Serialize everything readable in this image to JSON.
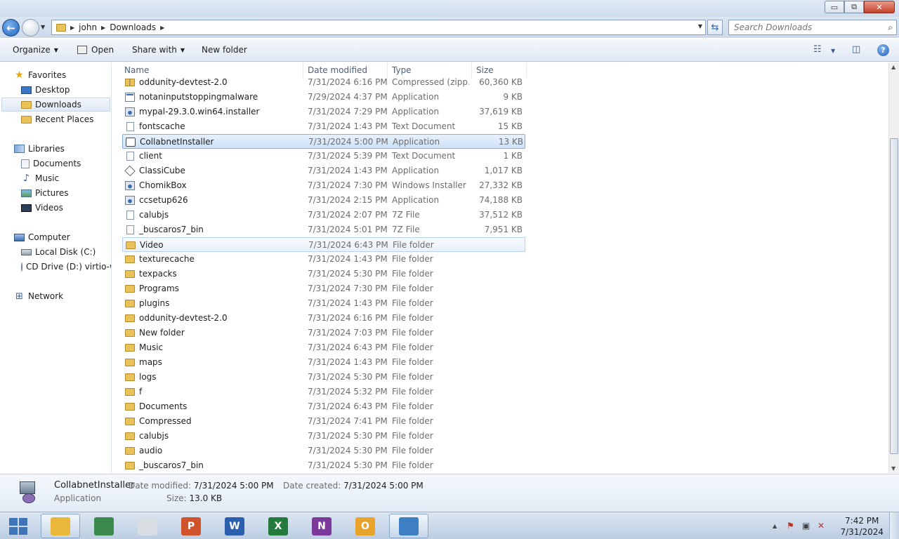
{
  "window": {
    "minimize": "▭",
    "maximize": "⧉",
    "close": "✕"
  },
  "address": {
    "crumbs": [
      "john",
      "Downloads"
    ],
    "search_placeholder": "Search Downloads"
  },
  "toolbar": {
    "organize": "Organize",
    "open": "Open",
    "share_with": "Share with",
    "new_folder": "New folder"
  },
  "nav": {
    "favorites": "Favorites",
    "desktop": "Desktop",
    "downloads": "Downloads",
    "recent_places": "Recent Places",
    "libraries": "Libraries",
    "documents": "Documents",
    "music": "Music",
    "pictures": "Pictures",
    "videos": "Videos",
    "computer": "Computer",
    "local_disk": "Local Disk (C:)",
    "cd_drive": "CD Drive (D:) virtio-w",
    "network": "Network"
  },
  "columns": {
    "name": "Name",
    "date": "Date modified",
    "type": "Type",
    "size": "Size"
  },
  "files": [
    {
      "name": "oddunity-devtest-2.0",
      "date": "7/31/2024 6:16 PM",
      "type": "Compressed (zipp...",
      "size": "60,360 KB",
      "icon": "zip"
    },
    {
      "name": "notaninputstoppingmalware",
      "date": "7/29/2024 4:37 PM",
      "type": "Application",
      "size": "9 KB",
      "icon": "app"
    },
    {
      "name": "mypal-29.3.0.win64.installer",
      "date": "7/31/2024 7:29 PM",
      "type": "Application",
      "size": "37,619 KB",
      "icon": "inst"
    },
    {
      "name": "fontscache",
      "date": "7/31/2024 1:43 PM",
      "type": "Text Document",
      "size": "15 KB",
      "icon": "txt"
    },
    {
      "name": "CollabnetInstaller",
      "date": "7/31/2024 5:00 PM",
      "type": "Application",
      "size": "13 KB",
      "icon": "gear"
    },
    {
      "name": "client",
      "date": "7/31/2024 5:39 PM",
      "type": "Text Document",
      "size": "1 KB",
      "icon": "txt"
    },
    {
      "name": "ClassiCube",
      "date": "7/31/2024 1:43 PM",
      "type": "Application",
      "size": "1,017 KB",
      "icon": "cube"
    },
    {
      "name": "ChomikBox",
      "date": "7/31/2024 7:30 PM",
      "type": "Windows Installer ...",
      "size": "27,332 KB",
      "icon": "inst"
    },
    {
      "name": "ccsetup626",
      "date": "7/31/2024 2:15 PM",
      "type": "Application",
      "size": "74,188 KB",
      "icon": "inst"
    },
    {
      "name": "calubjs",
      "date": "7/31/2024 2:07 PM",
      "type": "7Z File",
      "size": "37,512 KB",
      "icon": "txt"
    },
    {
      "name": "_buscaros7_bin",
      "date": "7/31/2024 5:01 PM",
      "type": "7Z File",
      "size": "7,951 KB",
      "icon": "txt"
    },
    {
      "name": "Video",
      "date": "7/31/2024 6:43 PM",
      "type": "File folder",
      "size": "",
      "icon": "folder"
    },
    {
      "name": "texturecache",
      "date": "7/31/2024 1:43 PM",
      "type": "File folder",
      "size": "",
      "icon": "folder"
    },
    {
      "name": "texpacks",
      "date": "7/31/2024 5:30 PM",
      "type": "File folder",
      "size": "",
      "icon": "folder"
    },
    {
      "name": "Programs",
      "date": "7/31/2024 7:30 PM",
      "type": "File folder",
      "size": "",
      "icon": "folder"
    },
    {
      "name": "plugins",
      "date": "7/31/2024 1:43 PM",
      "type": "File folder",
      "size": "",
      "icon": "folder"
    },
    {
      "name": "oddunity-devtest-2.0",
      "date": "7/31/2024 6:16 PM",
      "type": "File folder",
      "size": "",
      "icon": "folder"
    },
    {
      "name": "New folder",
      "date": "7/31/2024 7:03 PM",
      "type": "File folder",
      "size": "",
      "icon": "folder"
    },
    {
      "name": "Music",
      "date": "7/31/2024 6:43 PM",
      "type": "File folder",
      "size": "",
      "icon": "folder"
    },
    {
      "name": "maps",
      "date": "7/31/2024 1:43 PM",
      "type": "File folder",
      "size": "",
      "icon": "folder"
    },
    {
      "name": "logs",
      "date": "7/31/2024 5:30 PM",
      "type": "File folder",
      "size": "",
      "icon": "folder"
    },
    {
      "name": "f",
      "date": "7/31/2024 5:32 PM",
      "type": "File folder",
      "size": "",
      "icon": "folder"
    },
    {
      "name": "Documents",
      "date": "7/31/2024 6:43 PM",
      "type": "File folder",
      "size": "",
      "icon": "folder"
    },
    {
      "name": "Compressed",
      "date": "7/31/2024 7:41 PM",
      "type": "File folder",
      "size": "",
      "icon": "folder"
    },
    {
      "name": "calubjs",
      "date": "7/31/2024 5:30 PM",
      "type": "File folder",
      "size": "",
      "icon": "folder"
    },
    {
      "name": "audio",
      "date": "7/31/2024 5:30 PM",
      "type": "File folder",
      "size": "",
      "icon": "folder"
    },
    {
      "name": "_buscaros7_bin",
      "date": "7/31/2024 5:30 PM",
      "type": "File folder",
      "size": "",
      "icon": "folder"
    }
  ],
  "selected_file": "CollabnetInstaller",
  "hovered_file": "Video",
  "details": {
    "name": "CollabnetInstaller",
    "type": "Application",
    "date_modified_label": "Date modified:",
    "date_modified": "7/31/2024 5:00 PM",
    "date_created_label": "Date created:",
    "date_created": "7/31/2024 5:00 PM",
    "size_label": "Size:",
    "size": "13.0 KB"
  },
  "taskbar": {
    "apps": [
      {
        "name": "explorer",
        "letter": "",
        "color": "#e9b83a"
      },
      {
        "name": "chrome-like",
        "letter": "",
        "color": "#3b8a4c"
      },
      {
        "name": "box",
        "letter": "",
        "color": "#d8dde3"
      },
      {
        "name": "powerpoint",
        "letter": "P",
        "color": "#d0532c"
      },
      {
        "name": "word",
        "letter": "W",
        "color": "#2b5fad"
      },
      {
        "name": "excel",
        "letter": "X",
        "color": "#237a3c"
      },
      {
        "name": "onenote",
        "letter": "N",
        "color": "#7b3a9b"
      },
      {
        "name": "outlook",
        "letter": "O",
        "color": "#e8a32a"
      },
      {
        "name": "remote",
        "letter": "",
        "color": "#3d7fc2"
      }
    ],
    "time": "7:42 PM",
    "date": "7/31/2024"
  }
}
